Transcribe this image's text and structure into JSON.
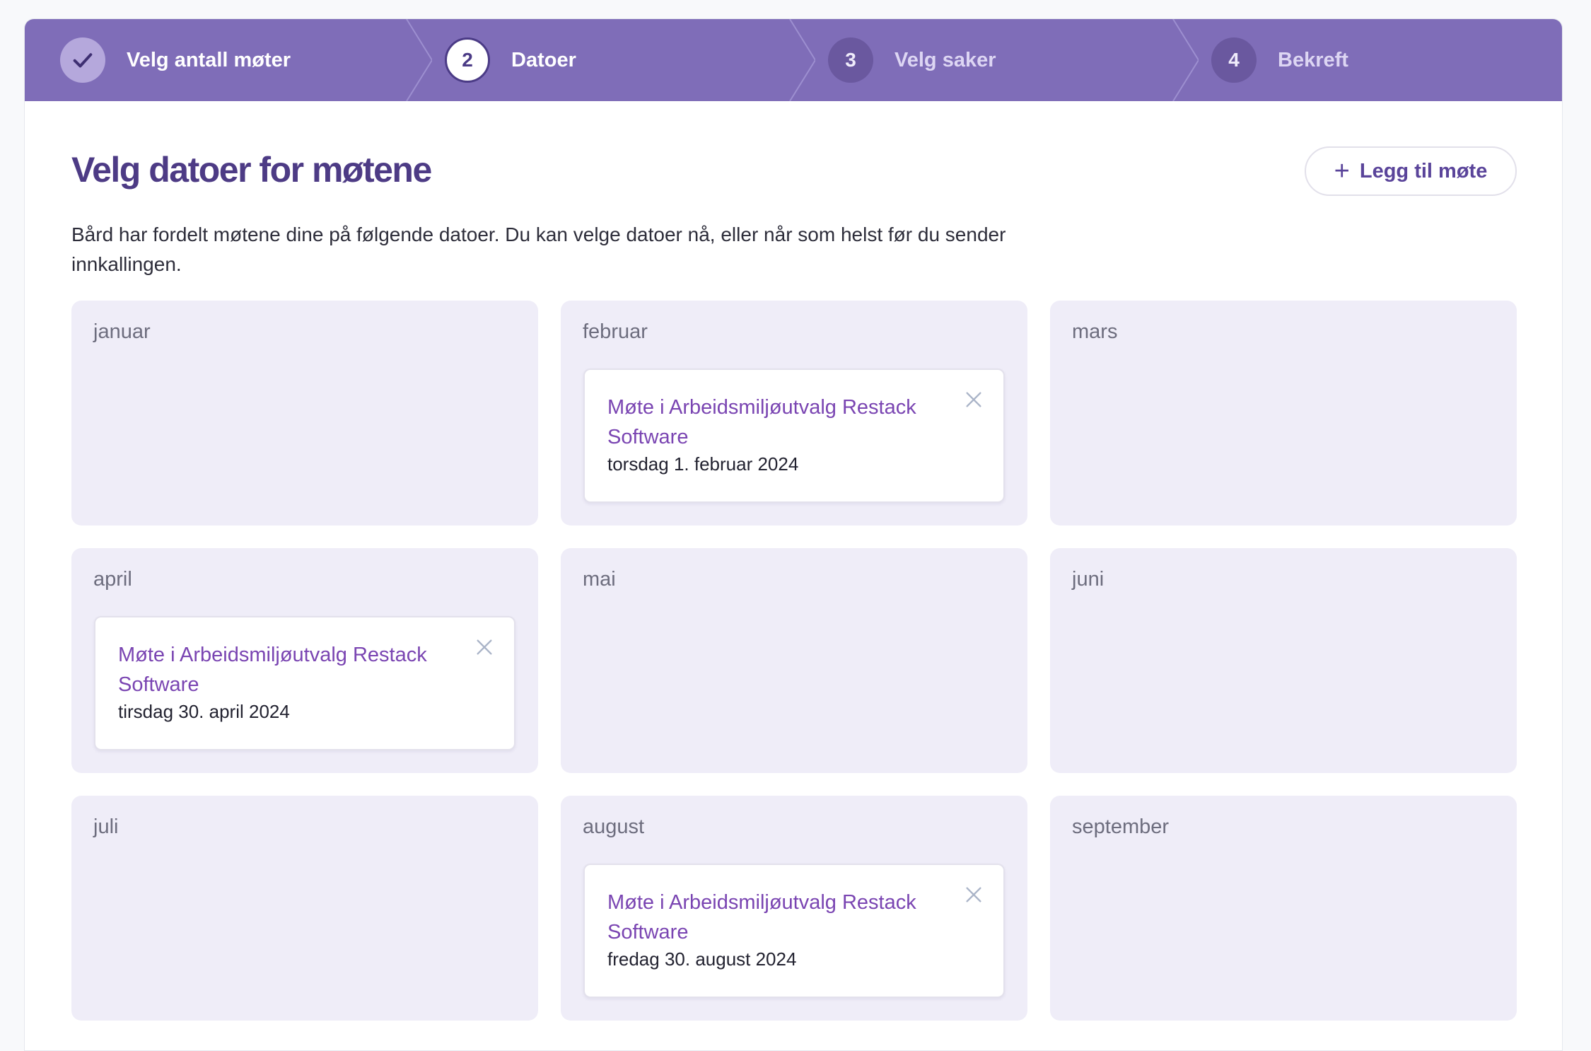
{
  "stepper": {
    "steps": [
      {
        "number": "",
        "label": "Velg antall møter",
        "state": "done",
        "icon": "check-icon"
      },
      {
        "number": "2",
        "label": "Datoer",
        "state": "current"
      },
      {
        "number": "3",
        "label": "Velg saker",
        "state": "upcoming"
      },
      {
        "number": "4",
        "label": "Bekreft",
        "state": "upcoming"
      }
    ]
  },
  "header": {
    "title": "Velg datoer for møtene",
    "add_button_label": "Legg til møte",
    "add_button_icon": "plus-icon"
  },
  "description": "Bård har fordelt møtene dine på følgende datoer. Du kan velge datoer nå, eller når som helst før du sender innkallingen.",
  "months": [
    {
      "name": "januar"
    },
    {
      "name": "februar",
      "meeting": {
        "title": "Møte i Arbeidsmiljøutvalg Restack Software",
        "date": "torsdag 1. februar 2024"
      }
    },
    {
      "name": "mars"
    },
    {
      "name": "april",
      "meeting": {
        "title": "Møte i Arbeidsmiljøutvalg Restack Software",
        "date": "tirsdag 30. april 2024"
      }
    },
    {
      "name": "mai"
    },
    {
      "name": "juni"
    },
    {
      "name": "juli"
    },
    {
      "name": "august",
      "meeting": {
        "title": "Møte i Arbeidsmiljøutvalg Restack Software",
        "date": "fredag 30. august 2024"
      }
    },
    {
      "name": "september"
    }
  ],
  "colors": {
    "stepper_bg": "#7f6db8",
    "title": "#4d3b85",
    "meeting_link": "#7a45b2",
    "month_bg": "#efedf8"
  }
}
